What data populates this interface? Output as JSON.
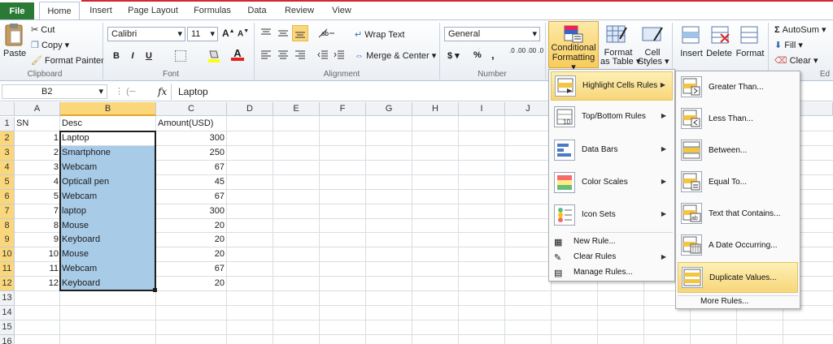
{
  "tabs": [
    "File",
    "Home",
    "Insert",
    "Page Layout",
    "Formulas",
    "Data",
    "Review",
    "View"
  ],
  "clipboard": {
    "paste": "Paste",
    "cut": "Cut",
    "copy": "Copy",
    "format_painter": "Format Painter",
    "label": "Clipboard"
  },
  "font": {
    "name": "Calibri",
    "size": "11",
    "bold": "B",
    "italic": "I",
    "underline": "U",
    "label": "Font"
  },
  "alignment": {
    "wrap_text": "Wrap Text",
    "merge_center": "Merge & Center",
    "label": "Alignment"
  },
  "number": {
    "format": "General",
    "label": "Number",
    "dollar": "$",
    "percent": "%",
    "comma": ",",
    "inc_dec": ".0 .00",
    "dec_dec": ".00 .0"
  },
  "styles": {
    "conditional_formatting": "Conditional Formatting",
    "format_as_table": "Format as Table",
    "cell_styles": "Cell Styles",
    "conditional_l1": "Conditional",
    "conditional_l2": "Formatting",
    "fat_l1": "Format",
    "fat_l2": "as Table",
    "cs_l1": "Cell",
    "cs_l2": "Styles"
  },
  "cells": {
    "insert": "Insert",
    "delete": "Delete",
    "format": "Format"
  },
  "editing": {
    "autosum": "AutoSum",
    "fill": "Fill",
    "clear": "Clear",
    "label": "Ed"
  },
  "formula_bar": {
    "name_box": "B2",
    "fx": "fx",
    "content": "Laptop"
  },
  "columns": [
    "A",
    "B",
    "C",
    "D",
    "E",
    "F",
    "G",
    "H",
    "I",
    "J",
    "K"
  ],
  "rows": [
    "1",
    "2",
    "3",
    "4",
    "5",
    "6",
    "7",
    "8",
    "9",
    "10",
    "11",
    "12",
    "13",
    "14",
    "15",
    "16"
  ],
  "sheet": {
    "headers": {
      "a": "SN",
      "b": "Desc",
      "c": "Amount(USD)"
    },
    "data": [
      {
        "sn": "1",
        "desc": "Laptop",
        "amt": "300"
      },
      {
        "sn": "2",
        "desc": "Smartphone",
        "amt": "250"
      },
      {
        "sn": "3",
        "desc": "Webcam",
        "amt": "67"
      },
      {
        "sn": "4",
        "desc": "Opticall pen",
        "amt": "45"
      },
      {
        "sn": "5",
        "desc": "Webcam",
        "amt": "67"
      },
      {
        "sn": "7",
        "desc": "laptop",
        "amt": "300"
      },
      {
        "sn": "8",
        "desc": "Mouse",
        "amt": "20"
      },
      {
        "sn": "9",
        "desc": "Keyboard",
        "amt": "20"
      },
      {
        "sn": "10",
        "desc": "Mouse",
        "amt": "20"
      },
      {
        "sn": "11",
        "desc": "Webcam",
        "amt": "67"
      },
      {
        "sn": "12",
        "desc": "Keyboard",
        "amt": "20"
      }
    ]
  },
  "cf_menu": {
    "highlight": "Highlight Cells Rules",
    "topbottom": "Top/Bottom Rules",
    "databars": "Data Bars",
    "colorscales": "Color Scales",
    "iconsets": "Icon Sets",
    "newrule": "New Rule...",
    "clearrules": "Clear Rules",
    "managerules": "Manage Rules..."
  },
  "hcr_menu": {
    "greater": "Greater Than...",
    "less": "Less Than...",
    "between": "Between...",
    "equal": "Equal To...",
    "text": "Text that Contains...",
    "date": "A Date Occurring...",
    "duplicate": "Duplicate Values...",
    "more": "More Rules..."
  },
  "colors": {
    "selection": "#a8cbe8",
    "highlight": "#f8d67a",
    "file_tab": "#2a7a35"
  }
}
